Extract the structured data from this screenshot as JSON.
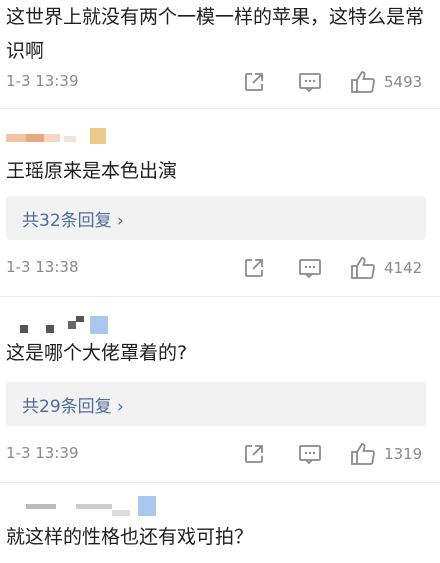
{
  "comments": [
    {
      "text": "这世界上就没有两个一模一样的苹果，这特么是常识啊",
      "time": "1-3 13:39",
      "likes": "5493"
    },
    {
      "text": "王瑶原来是本色出演",
      "reply_label": "共32条回复 ›",
      "time": "1-3 13:38",
      "likes": "4142"
    },
    {
      "text": "这是哪个大佬罩着的?",
      "reply_label": "共29条回复 ›",
      "time": "1-3 13:39",
      "likes": "1319"
    },
    {
      "text": "就这样的性格也还有戏可拍？"
    }
  ],
  "icons": {
    "share": "share-icon",
    "comment": "comment-icon",
    "like": "thumbs-up-icon"
  },
  "colors": {
    "reply_link": "#4d6e9c",
    "meta_gray": "#8a8a8a",
    "reply_bg": "#f2f2f2"
  }
}
